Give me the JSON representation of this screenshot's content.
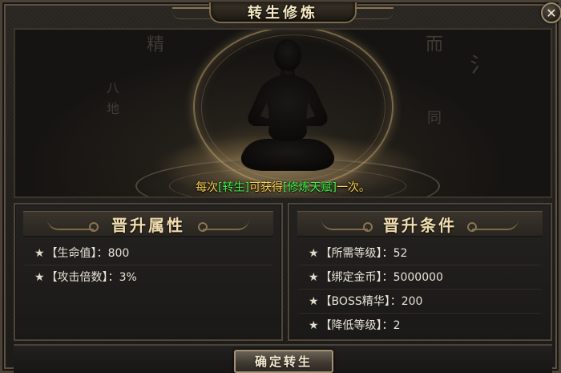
{
  "window": {
    "title": "转生修炼",
    "close_icon": "close-icon"
  },
  "banner": {
    "message_prefix": "每次",
    "message_highlight_1": "[转生]",
    "message_middle": "可获得",
    "message_highlight_2": "[修炼天赋]",
    "message_suffix": "一次。",
    "colors": {
      "plain": "#fbd24d",
      "highlight": "#41f54a"
    }
  },
  "attributes_panel": {
    "title": "晋升属性",
    "rows": [
      {
        "label": "【生命值】：",
        "value": "800"
      },
      {
        "label": "【攻击倍数】：",
        "value": "3%"
      }
    ]
  },
  "conditions_panel": {
    "title": "晋升条件",
    "rows": [
      {
        "label": "【所需等级】：",
        "value": "52"
      },
      {
        "label": "【绑定金币】：",
        "value": "5000000"
      },
      {
        "label": "【BOSS精华】：",
        "value": "200"
      },
      {
        "label": "【降低等级】：",
        "value": "2"
      }
    ]
  },
  "footer": {
    "confirm_label": "确定转生"
  }
}
